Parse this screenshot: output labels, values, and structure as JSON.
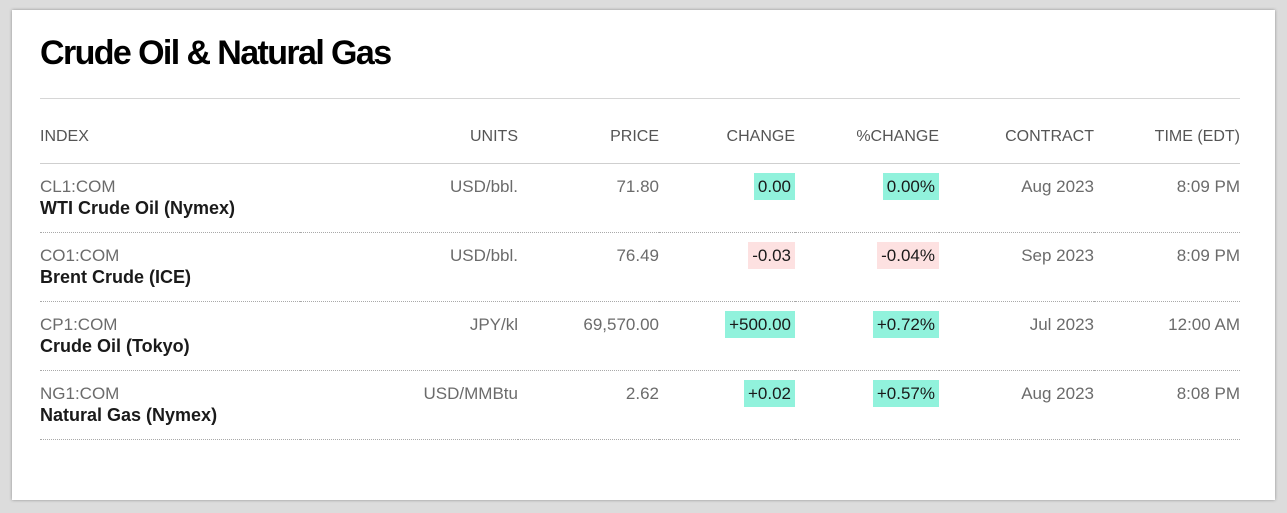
{
  "title": "Crude Oil & Natural Gas",
  "columns": {
    "index": "INDEX",
    "units": "UNITS",
    "price": "PRICE",
    "change": "CHANGE",
    "pct_change": "%CHANGE",
    "contract": "CONTRACT",
    "time": "TIME (EDT)"
  },
  "colors": {
    "positive_bg": "#91f2dc",
    "negative_bg": "#fde1e1"
  },
  "rows": [
    {
      "ticker": "CL1:COM",
      "name": "WTI Crude Oil (Nymex)",
      "units": "USD/bbl.",
      "price": "71.80",
      "change": "0.00",
      "pct_change": "0.00%",
      "direction": "up",
      "contract": "Aug 2023",
      "time": "8:09 PM"
    },
    {
      "ticker": "CO1:COM",
      "name": "Brent Crude (ICE)",
      "units": "USD/bbl.",
      "price": "76.49",
      "change": "-0.03",
      "pct_change": "-0.04%",
      "direction": "down",
      "contract": "Sep 2023",
      "time": "8:09 PM"
    },
    {
      "ticker": "CP1:COM",
      "name": "Crude Oil (Tokyo)",
      "units": "JPY/kl",
      "price": "69,570.00",
      "change": "+500.00",
      "pct_change": "+0.72%",
      "direction": "up",
      "contract": "Jul 2023",
      "time": "12:00 AM"
    },
    {
      "ticker": "NG1:COM",
      "name": "Natural Gas (Nymex)",
      "units": "USD/MMBtu",
      "price": "2.62",
      "change": "+0.02",
      "pct_change": "+0.57%",
      "direction": "up",
      "contract": "Aug 2023",
      "time": "8:08 PM"
    }
  ]
}
